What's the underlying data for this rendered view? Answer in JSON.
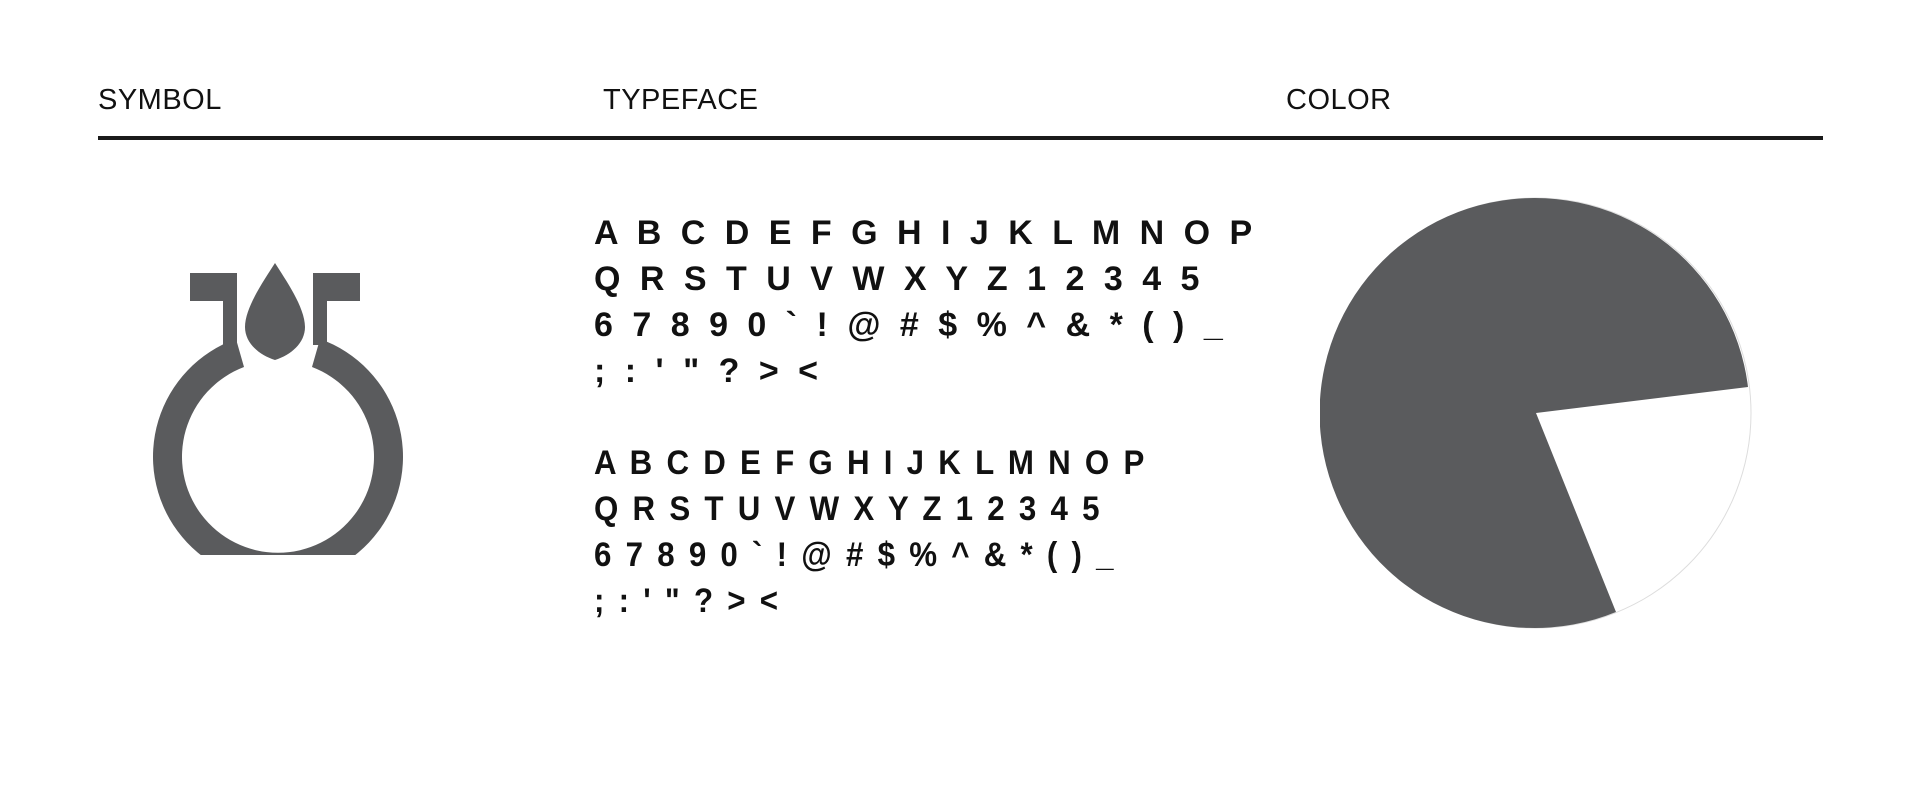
{
  "header": {
    "symbol_label": "SYMBOL",
    "typeface_label": "TYPEFACE",
    "color_label": "COLOR"
  },
  "symbol": {
    "icon": "ring-with-drop-icon",
    "color": "#5a5b5d"
  },
  "typeface": {
    "regular_lines": [
      "A B C D E F G H I J K L M N O P",
      "Q R S T U V W X Y Z 1 2 3 4 5",
      "6 7 8 9 0 ` ! @ # $ % ^ & * ( ) _",
      "; : ' \" ? > <"
    ],
    "condensed_lines": [
      "A B C D E F G H I J K L M N O P",
      "Q R S T U V W X Y Z 1 2 3 4 5",
      "6 7 8 9 0 ` ! @ # $ % ^ & * ( ) _",
      "; : ' \" ? > <"
    ]
  },
  "color": {
    "primary": "#5a5b5d",
    "secondary": "#ffffff"
  }
}
